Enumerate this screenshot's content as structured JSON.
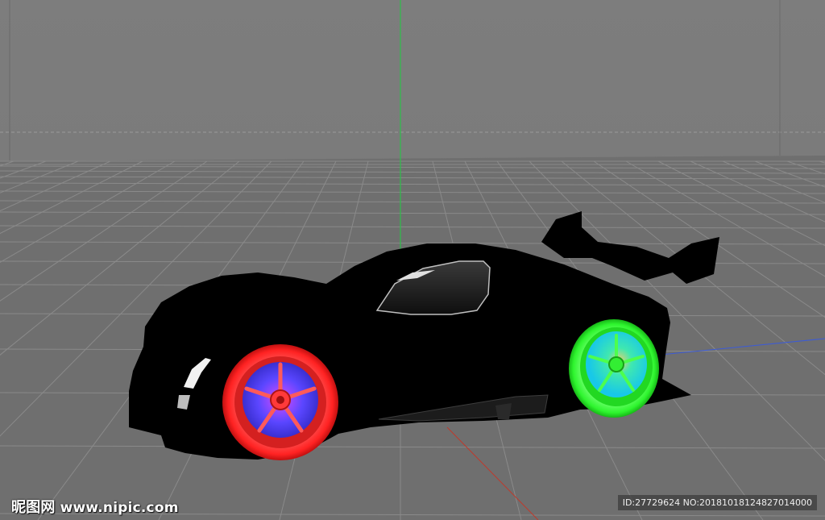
{
  "viewport": {
    "name": "3d-render-viewport",
    "background_top": "#7b7b7b",
    "floor_color": "#6f6f6f",
    "grid_color": "#8a8a8a",
    "axis_y_color": "#2fbf4a",
    "axis_x_color": "#c0392b",
    "axis_z_color": "#3c5bd6"
  },
  "car": {
    "body_color": "#000000",
    "front_wheel_tire_color": "#ff2b2b",
    "front_wheel_rim_color": "#6a4cff",
    "rear_wheel_tire_color": "#33ff33",
    "rear_wheel_rim_color": "#3fe8b0"
  },
  "watermark": {
    "site_cn": "昵图网",
    "site_url": "www.nipic.com",
    "id_text": "ID:27729624 NO:20181018124827014000"
  }
}
